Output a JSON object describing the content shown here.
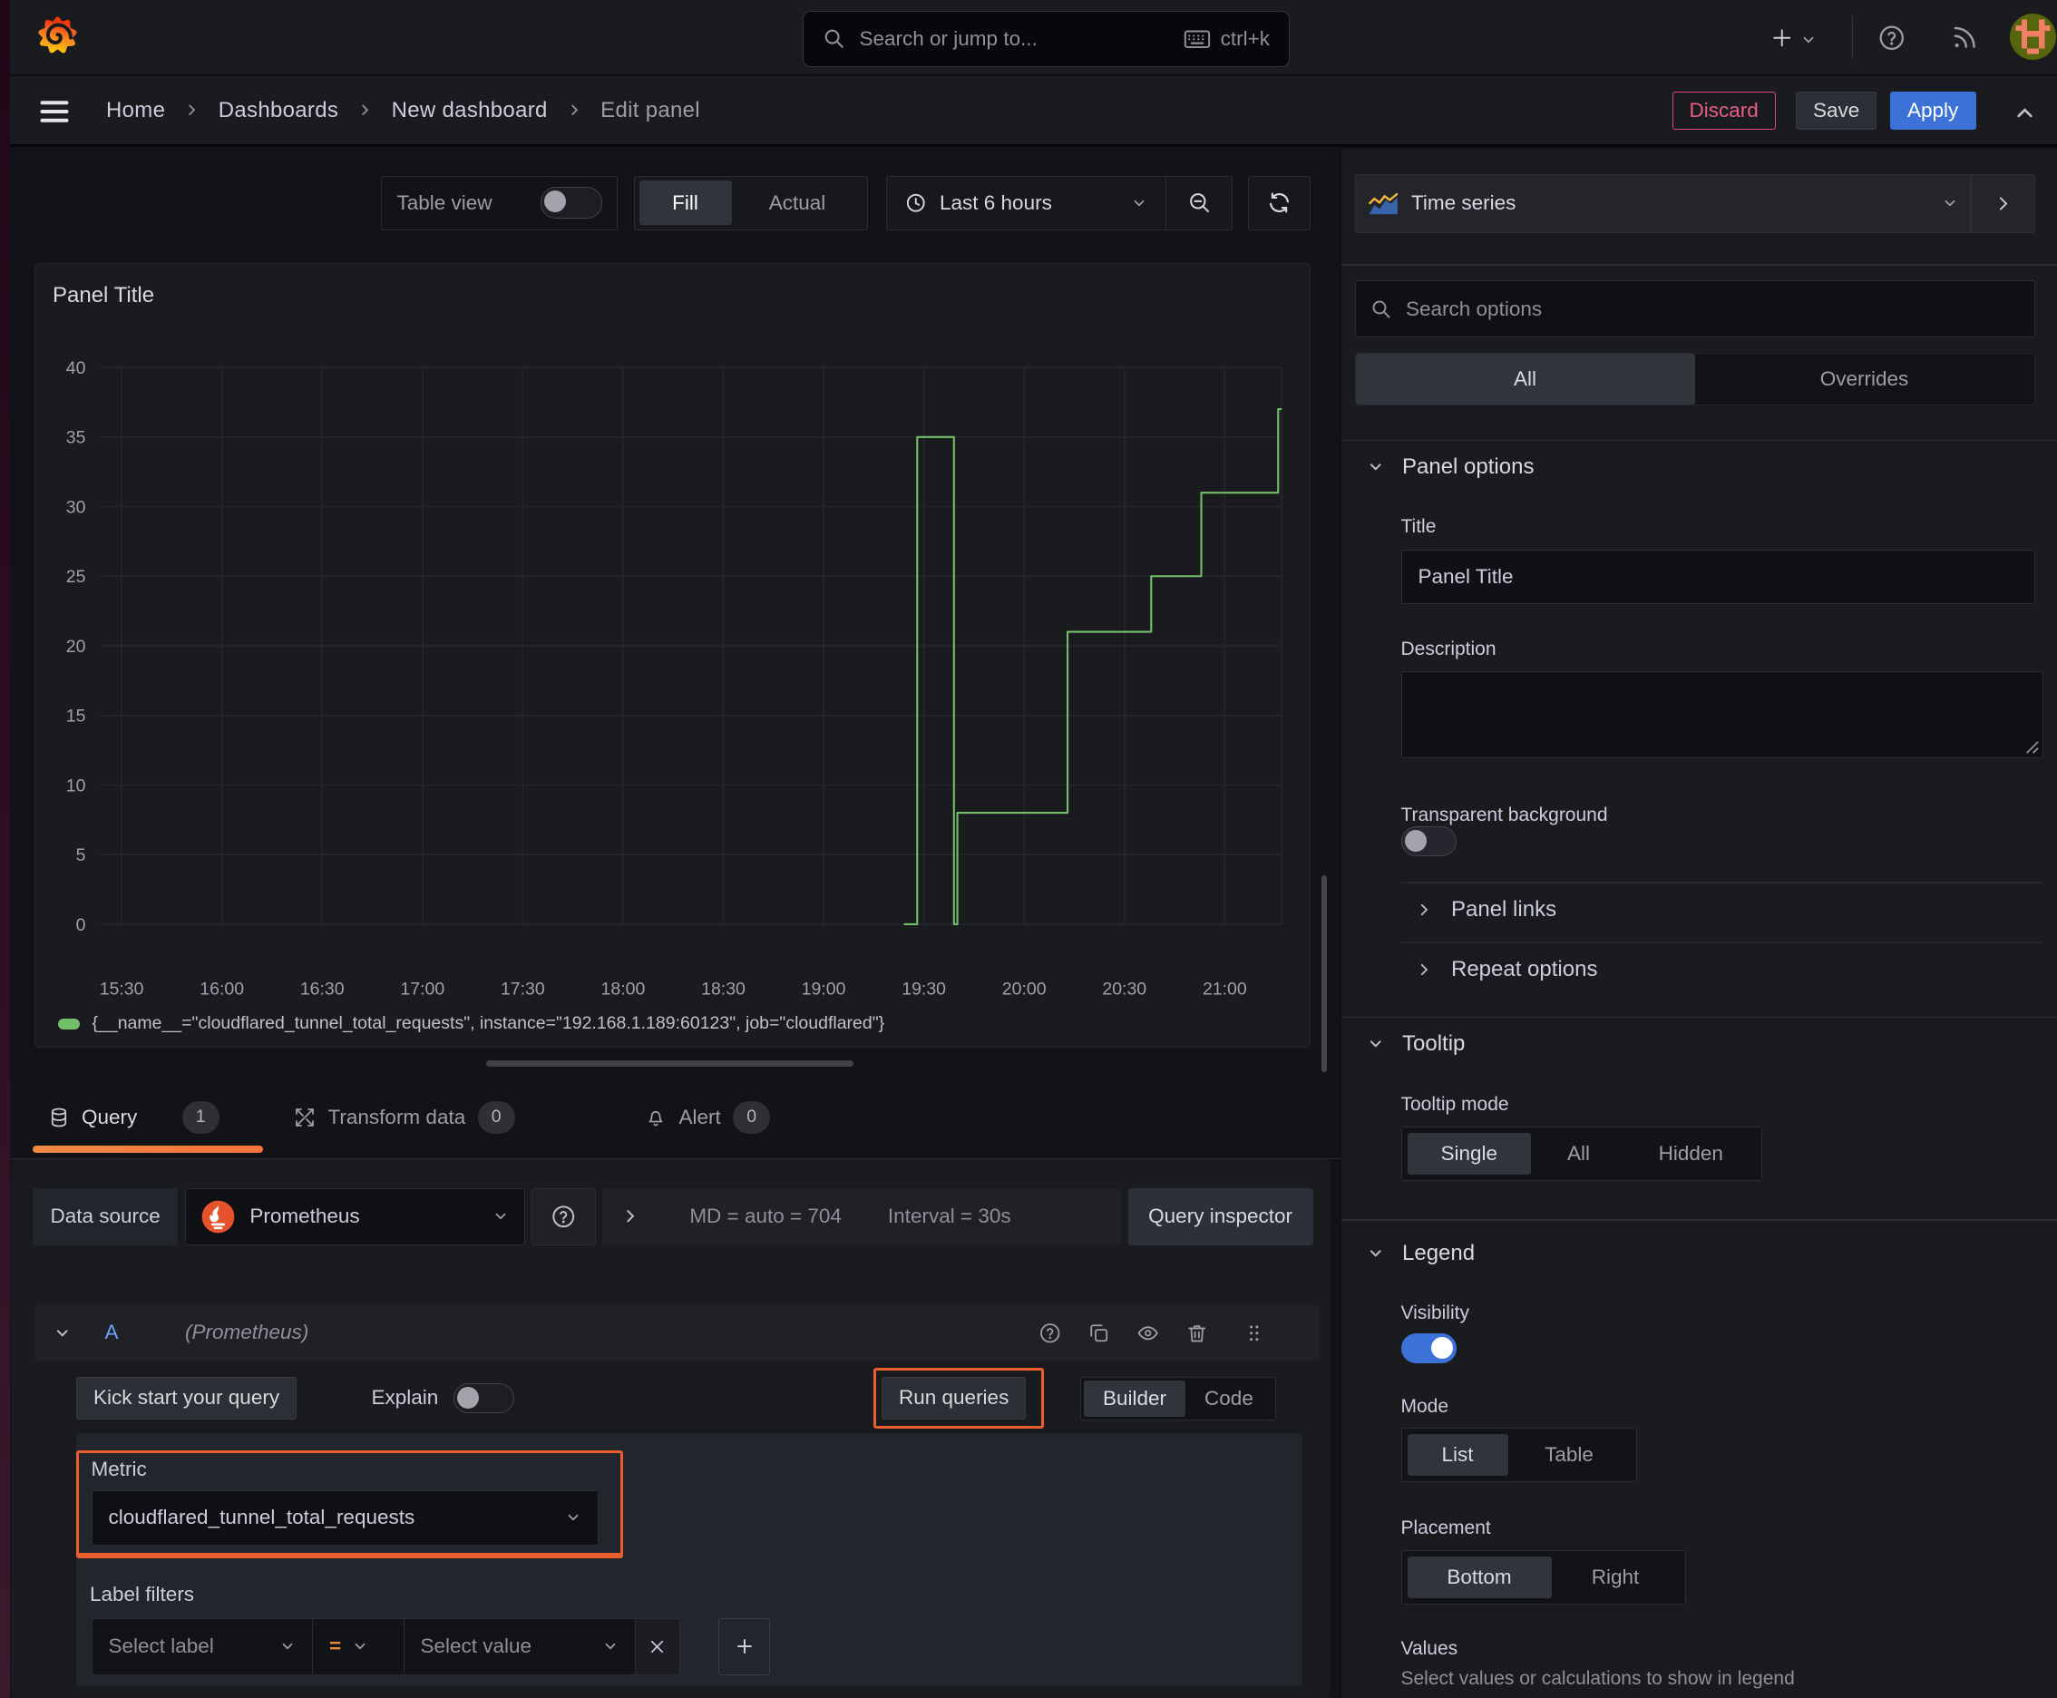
{
  "topbar": {
    "search_placeholder": "Search or jump to...",
    "search_shortcut": "ctrl+k"
  },
  "breadcrumb": {
    "items": [
      "Home",
      "Dashboards",
      "New dashboard",
      "Edit panel"
    ]
  },
  "actions": {
    "discard": "Discard",
    "save": "Save",
    "apply": "Apply"
  },
  "toolbar": {
    "table_view": "Table view",
    "fill": "Fill",
    "actual": "Actual",
    "time_range": "Last 6 hours"
  },
  "panel": {
    "title": "Panel Title",
    "legend": "{__name__=\"cloudflared_tunnel_total_requests\", instance=\"192.168.1.189:60123\", job=\"cloudflared\"}"
  },
  "chart_data": {
    "type": "line",
    "step": true,
    "grid": true,
    "legend_position": "bottom",
    "title": "Panel Title",
    "xlabel": "",
    "ylabel": "",
    "x_ticks": [
      "15:30",
      "16:00",
      "16:30",
      "17:00",
      "17:30",
      "18:00",
      "18:30",
      "19:00",
      "19:30",
      "20:00",
      "20:30",
      "21:00"
    ],
    "y_ticks": [
      0,
      5,
      10,
      15,
      20,
      25,
      30,
      35,
      40
    ],
    "ylim": [
      0,
      42.5
    ],
    "x_range_minutes": 347,
    "series": [
      {
        "name": "{__name__=\"cloudflared_tunnel_total_requests\", instance=\"192.168.1.189:60123\", job=\"cloudflared\"}",
        "color": "#73bf69",
        "points": [
          [
            "19:24",
            0
          ],
          [
            "19:28",
            0
          ],
          [
            "19:28",
            35
          ],
          [
            "19:39",
            35
          ],
          [
            "19:39",
            0
          ],
          [
            "19:40",
            0
          ],
          [
            "19:40",
            8
          ],
          [
            "20:13",
            8
          ],
          [
            "20:13",
            21
          ],
          [
            "20:38",
            21
          ],
          [
            "20:38",
            25
          ],
          [
            "20:53",
            25
          ],
          [
            "20:53",
            31
          ],
          [
            "21:16",
            31
          ],
          [
            "21:16",
            37
          ],
          [
            "21:17",
            37
          ]
        ]
      }
    ]
  },
  "query": {
    "tabs": [
      {
        "label": "Query",
        "badge": "1"
      },
      {
        "label": "Transform data",
        "badge": "0"
      },
      {
        "label": "Alert",
        "badge": "0"
      }
    ],
    "datasource_label": "Data source",
    "datasource": "Prometheus",
    "stats": "MD = auto = 704",
    "interval": "Interval = 30s",
    "inspector": "Query inspector",
    "row_letter": "A",
    "row_ds": "(Prometheus)",
    "kick_start": "Kick start your query",
    "explain": "Explain",
    "run": "Run queries",
    "builder": "Builder",
    "code": "Code",
    "metric_label": "Metric",
    "metric_value": "cloudflared_tunnel_total_requests",
    "label_filters": "Label filters",
    "select_label": "Select label",
    "eq": "=",
    "select_value": "Select value"
  },
  "options": {
    "viz": "Time series",
    "search_placeholder": "Search options",
    "tab_all": "All",
    "tab_overrides": "Overrides",
    "panel_options": "Panel options",
    "title_label": "Title",
    "title_value": "Panel Title",
    "description": "Description",
    "transparent": "Transparent background",
    "panel_links": "Panel links",
    "repeat": "Repeat options",
    "tooltip": "Tooltip",
    "tooltip_mode": "Tooltip mode",
    "mode_single": "Single",
    "mode_all": "All",
    "mode_hidden": "Hidden",
    "legend": "Legend",
    "visibility": "Visibility",
    "mode": "Mode",
    "list": "List",
    "table": "Table",
    "placement": "Placement",
    "bottom": "Bottom",
    "right": "Right",
    "values": "Values",
    "values_hint": "Select values or calculations to show in legend"
  }
}
